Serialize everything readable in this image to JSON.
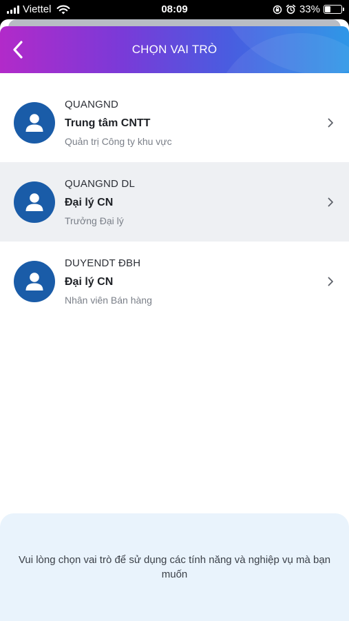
{
  "status_bar": {
    "carrier": "Viettel",
    "time": "08:09",
    "battery": "33%",
    "battery_level": 0.33,
    "icons": [
      "signal-icon",
      "wifi-icon",
      "rotation-lock-icon",
      "alarm-icon",
      "battery-icon"
    ]
  },
  "header": {
    "title": "CHỌN VAI TRÒ",
    "back_icon": "chevron-left-icon"
  },
  "roles": [
    {
      "username": "QUANGND",
      "unit": "Trung tâm CNTT",
      "position": "Quản trị Công ty khu vực",
      "selected": false
    },
    {
      "username": "QUANGND DL",
      "unit": "Đại lý CN",
      "position": "Trưởng Đại lý",
      "selected": true
    },
    {
      "username": "DUYENDT ĐBH",
      "unit": "Đại lý CN",
      "position": "Nhân viên Bán hàng",
      "selected": false
    }
  ],
  "footer": {
    "message": "Vui lòng chọn vai trò để sử dụng các tính năng và nghiệp vụ mà bạn muốn"
  },
  "colors": {
    "header_gradient": [
      "#b22ac9",
      "#1f8fe6"
    ],
    "avatar_bg": "#1a5ca8",
    "selected_row_bg": "#eef0f3",
    "footer_bg": "#e9f3fc"
  }
}
